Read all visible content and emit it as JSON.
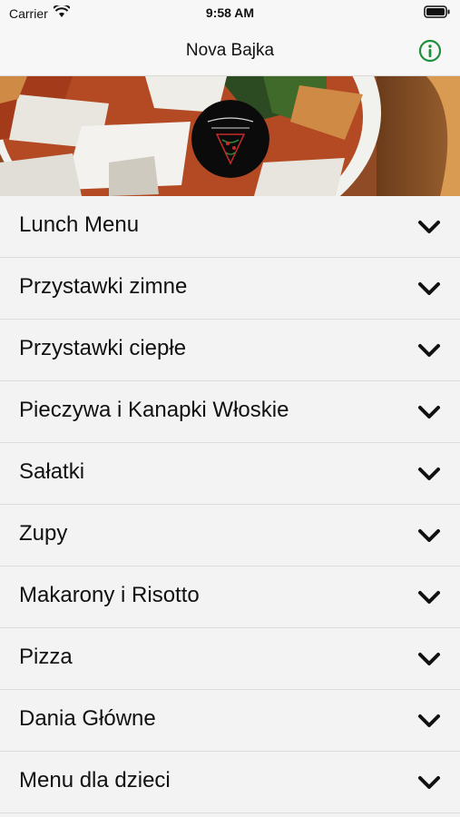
{
  "status_bar": {
    "carrier": "Carrier",
    "time": "9:58 AM"
  },
  "nav": {
    "title": "Nova Bajka",
    "info_icon": "info-circle-icon",
    "accent_color": "#1e8f3a"
  },
  "hero": {
    "image_alt": "pizza photo",
    "logo": "Nowa Bajka logo"
  },
  "menu": {
    "items": [
      {
        "label": "Lunch Menu"
      },
      {
        "label": "Przystawki zimne"
      },
      {
        "label": "Przystawki ciepłe"
      },
      {
        "label": "Pieczywa i Kanapki Włoskie"
      },
      {
        "label": "Sałatki"
      },
      {
        "label": "Zupy"
      },
      {
        "label": "Makarony i Risotto"
      },
      {
        "label": "Pizza"
      },
      {
        "label": "Dania Główne"
      },
      {
        "label": "Menu dla dzieci"
      }
    ]
  }
}
